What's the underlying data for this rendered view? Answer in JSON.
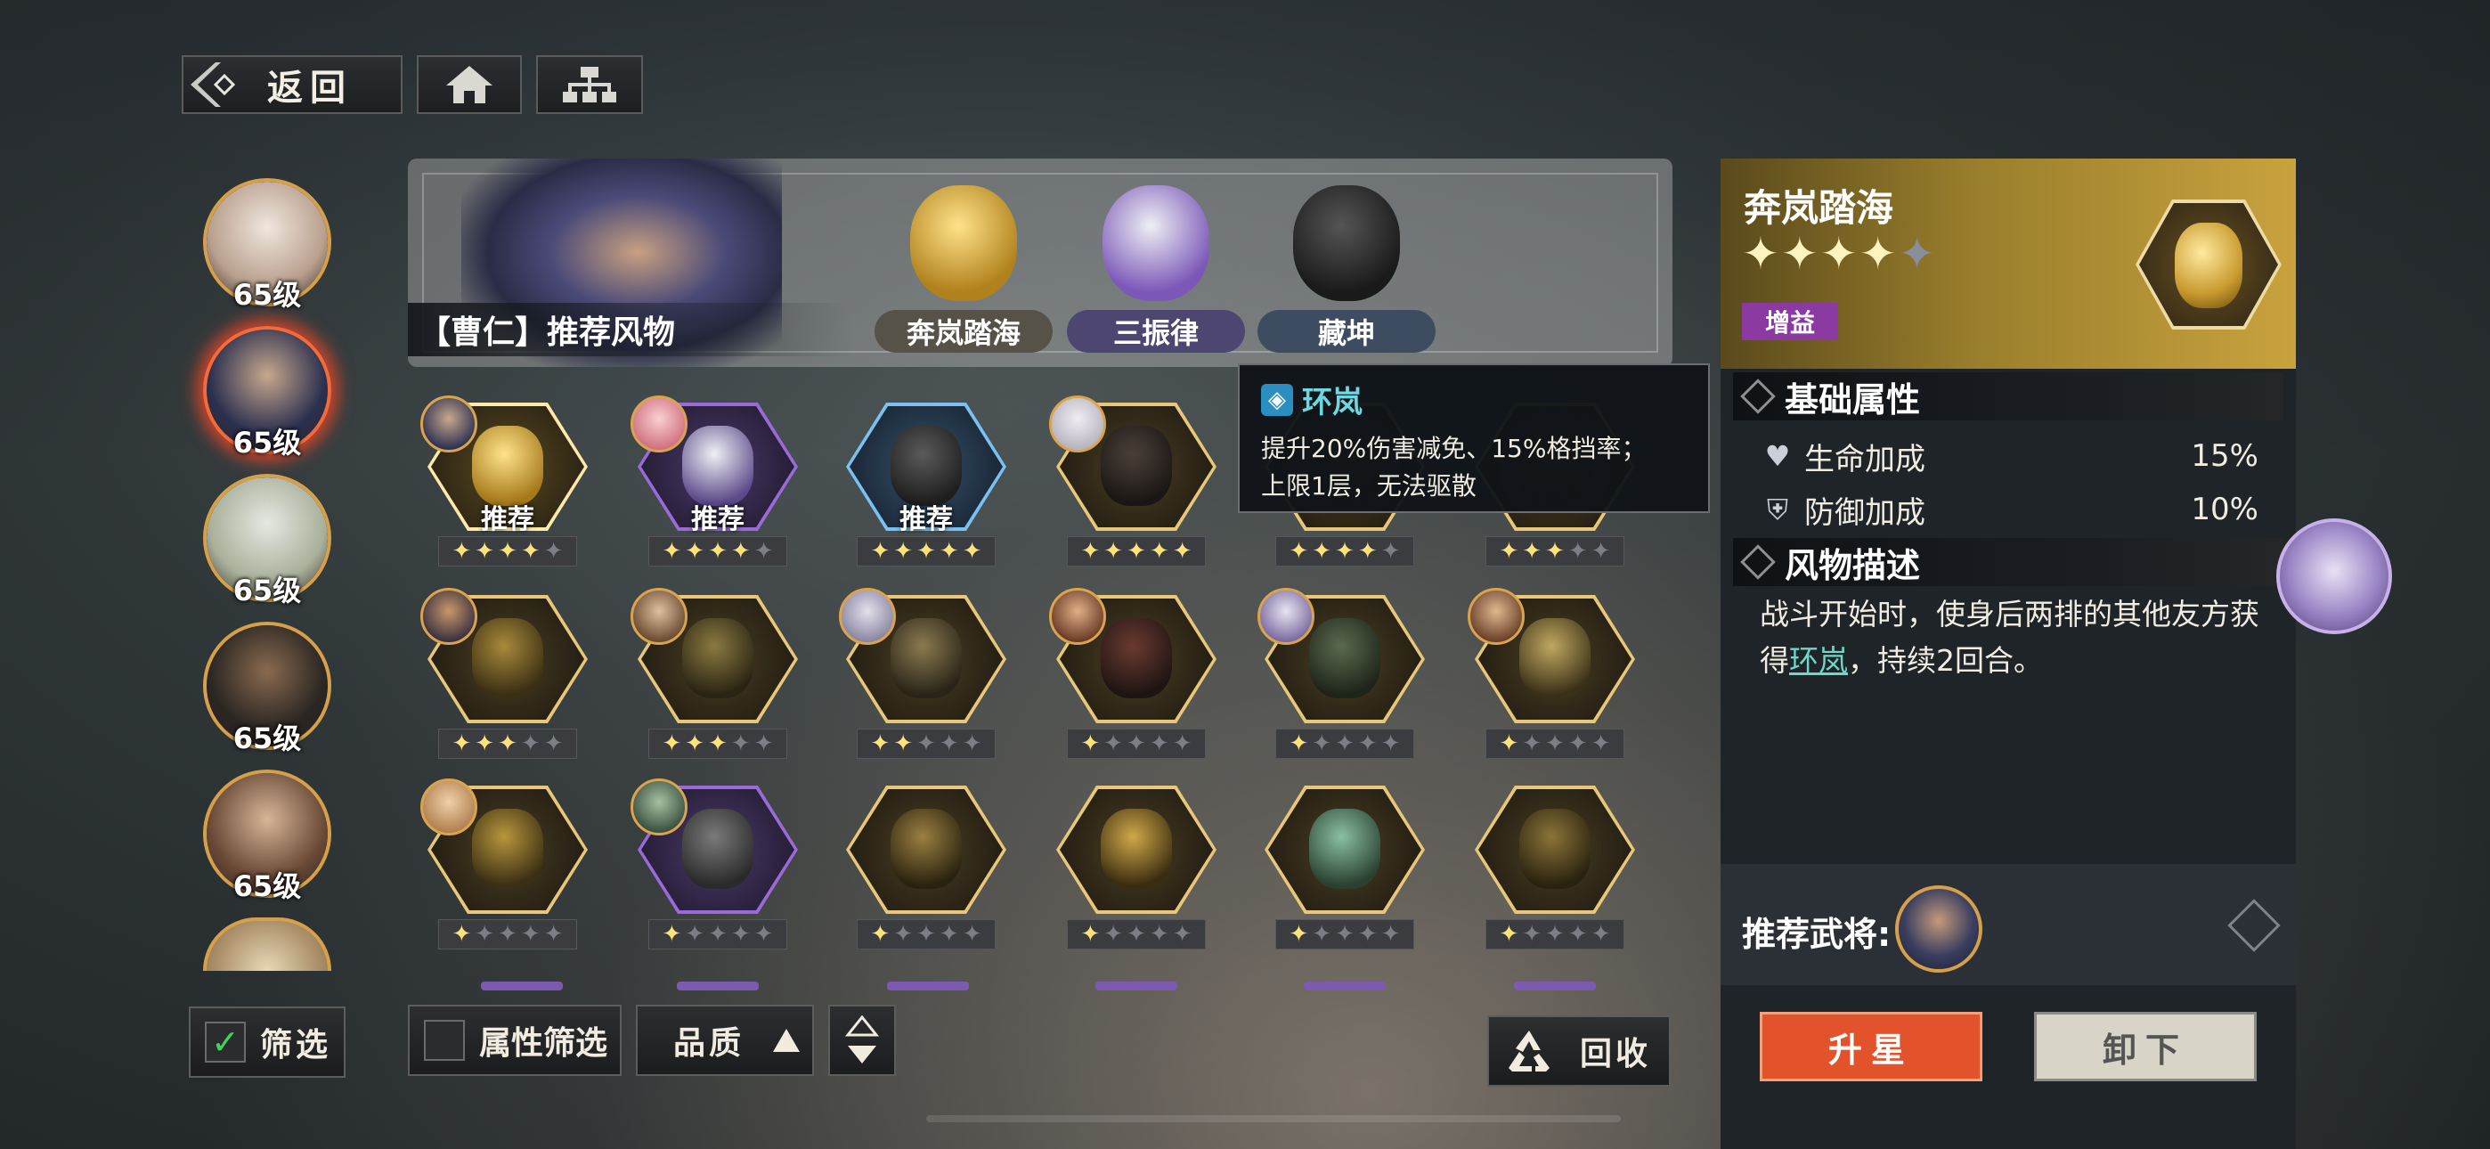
{
  "nav": {
    "back_label": "返回",
    "home_icon": "home-icon",
    "tree_icon": "hierarchy-icon"
  },
  "heroes": [
    {
      "level": "65级",
      "colors": [
        "#f0e6de",
        "#b9a08e"
      ],
      "selected": false
    },
    {
      "level": "65级",
      "colors": [
        "#c7a88c",
        "#2c3050"
      ],
      "selected": true
    },
    {
      "level": "65级",
      "colors": [
        "#e6e8e2",
        "#a9b09a"
      ],
      "selected": false
    },
    {
      "level": "65级",
      "colors": [
        "#8a6a50",
        "#2a2622"
      ],
      "selected": false
    },
    {
      "level": "65级",
      "colors": [
        "#d8b598",
        "#6a4a36"
      ],
      "selected": false
    }
  ],
  "banner": {
    "title": "【曹仁】推荐风物",
    "items": [
      {
        "name": "奔岚踏海",
        "pill_color": "#565248",
        "art": [
          "#ffe38a",
          "#b0811c"
        ]
      },
      {
        "name": "三振律",
        "pill_color": "#4c4670",
        "art": [
          "#eef0f4",
          "#7b57b8"
        ]
      },
      {
        "name": "藏坤",
        "pill_color": "#3e4c62",
        "art": [
          "#555",
          "#1a1a1a"
        ]
      }
    ]
  },
  "grid": {
    "rows": [
      [
        {
          "tag": "推荐",
          "stars": 4,
          "frame": "gold-selected",
          "art": [
            "#ffe38a",
            "#a5781a"
          ],
          "avatar": [
            "#c7a88c",
            "#2c3050"
          ]
        },
        {
          "tag": "推荐",
          "stars": 4,
          "frame": "purple",
          "art": [
            "#eef0f4",
            "#5c4a8a"
          ],
          "avatar": [
            "#f8d0d0",
            "#d07080"
          ]
        },
        {
          "tag": "推荐",
          "stars": 5,
          "frame": "blue",
          "art": [
            "#5a5a5a",
            "#1e1e1e"
          ],
          "avatar": null
        },
        {
          "tag": "",
          "stars": 5,
          "frame": "gold",
          "art": [
            "#4a4038",
            "#1a1614"
          ],
          "avatar": [
            "#f0eef2",
            "#b7b4c0"
          ]
        },
        {
          "tag": "",
          "stars": 4,
          "frame": "gold",
          "art": [
            "#6a5628",
            "#2a2214"
          ],
          "avatar": null
        },
        {
          "tag": "",
          "stars": 3,
          "frame": "gold",
          "art": [
            "#6a5628",
            "#2a2214"
          ],
          "avatar": null
        }
      ],
      [
        {
          "tag": "",
          "stars": 3,
          "frame": "gold",
          "art": [
            "#a88a3a",
            "#3a2e14"
          ],
          "avatar": [
            "#c89868",
            "#3a3040"
          ]
        },
        {
          "tag": "",
          "stars": 3,
          "frame": "gold",
          "art": [
            "#8a7a40",
            "#2a2414"
          ],
          "avatar": [
            "#e0c0a0",
            "#6a4a30"
          ]
        },
        {
          "tag": "",
          "stars": 2,
          "frame": "gold",
          "art": [
            "#8a7a50",
            "#2a2418"
          ],
          "avatar": [
            "#e4e0ee",
            "#8a86a0"
          ]
        },
        {
          "tag": "",
          "stars": 1,
          "frame": "gold",
          "art": [
            "#6a3a30",
            "#1e1412"
          ],
          "avatar": [
            "#e0b08a",
            "#6a3a26"
          ]
        },
        {
          "tag": "",
          "stars": 1,
          "frame": "gold",
          "art": [
            "#5a6a50",
            "#1e2418"
          ],
          "avatar": [
            "#e8e4f0",
            "#7a6aa0"
          ]
        },
        {
          "tag": "",
          "stars": 1,
          "frame": "gold",
          "art": [
            "#c0a860",
            "#3a3018"
          ],
          "avatar": [
            "#e0b890",
            "#6a4028"
          ]
        }
      ],
      [
        {
          "tag": "",
          "stars": 1,
          "frame": "gold",
          "art": [
            "#b8963c",
            "#3a2e14"
          ],
          "avatar": [
            "#f0d0a8",
            "#b08050"
          ]
        },
        {
          "tag": "",
          "stars": 1,
          "frame": "purple",
          "art": [
            "#7a7a7a",
            "#2a2a2a"
          ],
          "avatar": [
            "#a8c0a0",
            "#3a5040"
          ]
        },
        {
          "tag": "",
          "stars": 1,
          "frame": "gold",
          "art": [
            "#9a8040",
            "#2a2210"
          ],
          "avatar": null
        },
        {
          "tag": "",
          "stars": 1,
          "frame": "gold",
          "art": [
            "#d0a848",
            "#3a2c10"
          ],
          "avatar": null
        },
        {
          "tag": "",
          "stars": 1,
          "frame": "gold",
          "art": [
            "#8ac0a0",
            "#2a4030"
          ],
          "avatar": null
        },
        {
          "tag": "",
          "stars": 1,
          "frame": "gold",
          "art": [
            "#8a7438",
            "#2a2210"
          ],
          "avatar": null
        }
      ]
    ]
  },
  "tooltip": {
    "title": "环岚",
    "line1": "提升20%伤害减免、15%格挡率；",
    "line2": "上限1层，无法驱散"
  },
  "panel": {
    "title": "奔岚踏海",
    "stars": 4,
    "max_stars": 5,
    "badge": "增益",
    "section_attrs": "基础属性",
    "attrs": [
      {
        "name": "生命加成",
        "value": "15%",
        "icon": "heart-plus-icon"
      },
      {
        "name": "防御加成",
        "value": "10%",
        "icon": "shield-plus-icon"
      }
    ],
    "section_desc": "风物描述",
    "desc_part1": "战斗开始时，使身后两排的其他友方获得",
    "desc_link": "环岚",
    "desc_part2": "，持续2回合。",
    "rec_label": "推荐武将:",
    "btn_star": "升星",
    "btn_unload": "卸下"
  },
  "bottom": {
    "filter_label": "筛选",
    "attr_filter_label": "属性筛选",
    "quality_label": "品质",
    "recycle_label": "回收"
  },
  "colors": {
    "gold": "#e8c878",
    "purple": "#9a6ad8",
    "blue": "#7ac0f0",
    "accent_red": "#e2532c"
  }
}
